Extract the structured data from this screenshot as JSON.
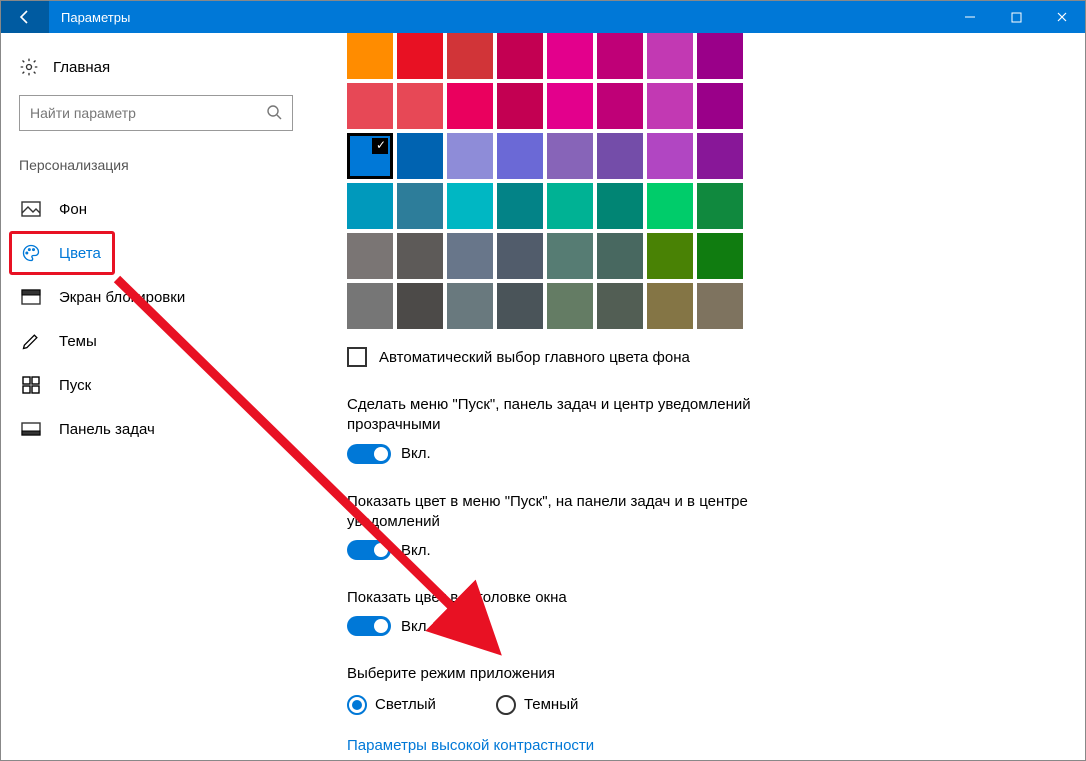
{
  "window": {
    "title": "Параметры"
  },
  "sidebar": {
    "home": "Главная",
    "search_placeholder": "Найти параметр",
    "section": "Персонализация",
    "items": [
      {
        "label": "Фон"
      },
      {
        "label": "Цвета"
      },
      {
        "label": "Экран блокировки"
      },
      {
        "label": "Темы"
      },
      {
        "label": "Пуск"
      },
      {
        "label": "Панель задач"
      }
    ]
  },
  "content": {
    "colors": [
      "#ff8c00",
      "#e81123",
      "#d13438",
      "#c30052",
      "#e3008c",
      "#bf0077",
      "#c239b3",
      "#9a0089",
      "#e74856",
      "#e74856",
      "#ea005e",
      "#c30052",
      "#e3008c",
      "#bf0077",
      "#c239b3",
      "#9a0089",
      "#0078d7",
      "#0063b1",
      "#8e8cd8",
      "#6b69d6",
      "#8764b8",
      "#744da9",
      "#b146c2",
      "#881798",
      "#0099bc",
      "#2d7d9a",
      "#00b7c3",
      "#038387",
      "#00b294",
      "#018574",
      "#00cc6a",
      "#10893e",
      "#7a7574",
      "#5d5a58",
      "#68768a",
      "#515c6b",
      "#567c73",
      "#486860",
      "#498205",
      "#107c10",
      "#767676",
      "#4c4a48",
      "#69797e",
      "#4a5459",
      "#647c64",
      "#525e54",
      "#847545",
      "#7e735f"
    ],
    "selected_color_index": 16,
    "auto_color_checkbox": "Автоматический выбор главного цвета фона",
    "settings": [
      {
        "label": "Сделать меню \"Пуск\", панель задач и центр уведомлений прозрачными",
        "state": "Вкл."
      },
      {
        "label": "Показать цвет в меню \"Пуск\", на панели задач и в центре уведомлений",
        "state": "Вкл."
      },
      {
        "label": "Показать цвет в заголовке окна",
        "state": "Вкл."
      }
    ],
    "app_mode": {
      "label": "Выберите режим приложения",
      "options": [
        "Светлый",
        "Темный"
      ],
      "selected": 0
    },
    "high_contrast_link": "Параметры высокой контрастности"
  }
}
